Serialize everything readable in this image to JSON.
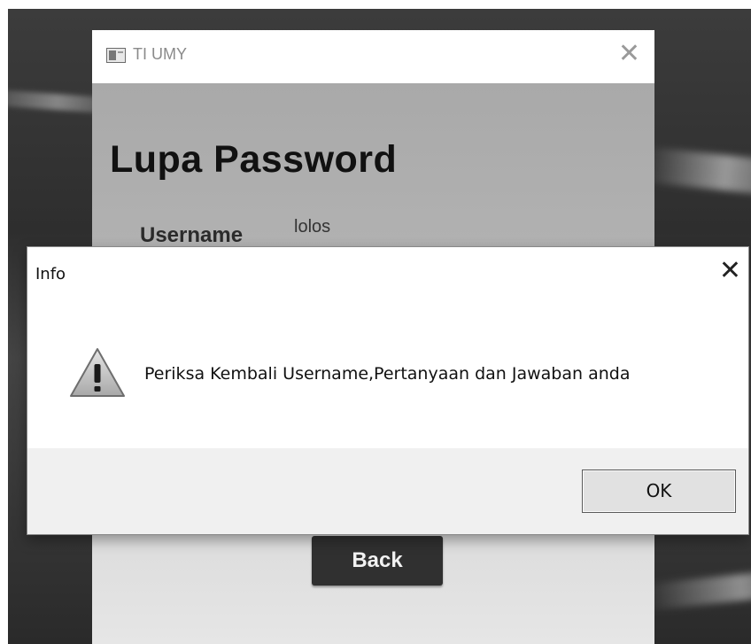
{
  "app_window": {
    "title": "TI UMY",
    "close_glyph": "✕",
    "page_title": "Lupa Password",
    "username_label": "Username",
    "username_value": "lolos",
    "back_label": "Back"
  },
  "dialog": {
    "title": "Info",
    "close_glyph": "✕",
    "message": "Periksa Kembali Username,Pertanyaan dan Jawaban anda",
    "icon": "warning-icon",
    "ok_label": "OK"
  }
}
